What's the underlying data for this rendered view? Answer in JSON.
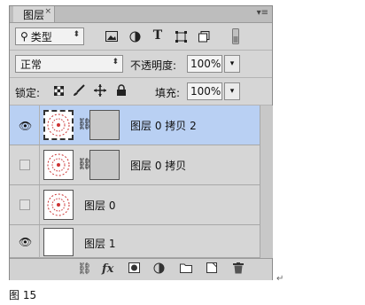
{
  "panel": {
    "tab_label": "图层",
    "close_glyph": "×",
    "menu_glyph": "▾≡"
  },
  "filter": {
    "kind_label": "类型",
    "search_glyph": "⚲",
    "icons": [
      "image-filter-icon",
      "adjustment-filter-icon",
      "type-filter-icon",
      "shape-filter-icon",
      "smart-object-filter-icon",
      "filter-toggle-icon"
    ]
  },
  "blend": {
    "mode": "正常",
    "opacity_label": "不透明度:",
    "opacity_value": "100%"
  },
  "lock": {
    "label": "锁定:",
    "fill_label": "填充:",
    "fill_value": "100%"
  },
  "layers": [
    {
      "name": "图层 0 拷贝 2",
      "visible": true,
      "selected": true,
      "has_mask": true
    },
    {
      "name": "图层 0 拷贝",
      "visible": false,
      "selected": false,
      "has_mask": true
    },
    {
      "name": "图层 0",
      "visible": false,
      "selected": false,
      "has_mask": false
    },
    {
      "name": "图层 1",
      "visible": true,
      "selected": false,
      "has_mask": false
    }
  ],
  "footer_icons": [
    "link-layers-icon",
    "fx-icon",
    "add-mask-icon",
    "adjustment-layer-icon",
    "new-group-icon",
    "new-layer-icon",
    "delete-layer-icon"
  ],
  "fx_label": "fx",
  "caption": "图 15",
  "return_mark": "↵"
}
